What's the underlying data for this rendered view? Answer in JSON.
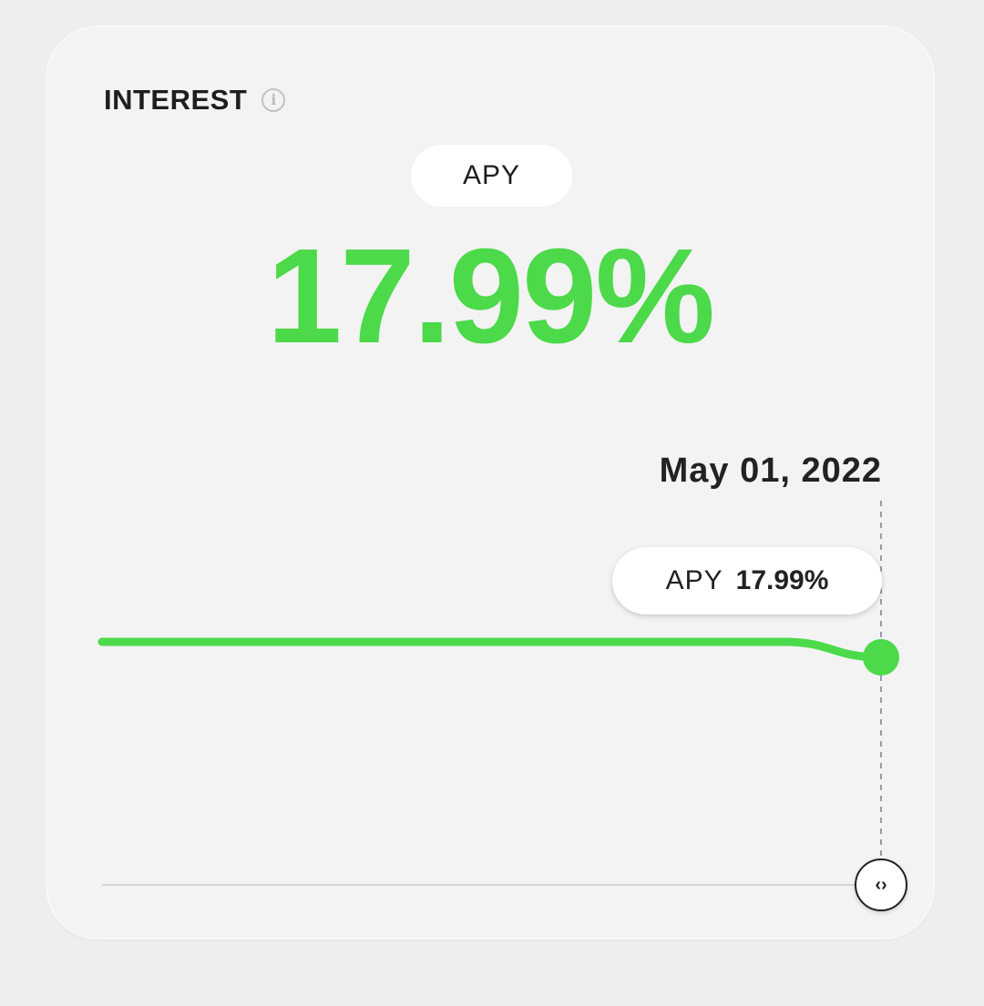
{
  "card": {
    "title": "INTEREST",
    "info_icon": "info-icon",
    "metric_pill": "APY",
    "main_value": "17.99%"
  },
  "colors": {
    "accent_green": "#4cd94a",
    "card_bg": "#f3f3f3",
    "text_dark": "#1e1e1e"
  },
  "tooltip": {
    "date": "May 01, 2022",
    "label": "APY",
    "value": "17.99%"
  },
  "scrubber": {
    "icon": "chevron-left-right-icon",
    "glyph": "‹›"
  },
  "chart_data": {
    "type": "line",
    "series": [
      {
        "values": [
          18.0,
          18.0,
          18.0,
          18.0,
          18.0,
          18.0,
          18.0,
          18.0,
          17.99
        ]
      }
    ],
    "grid": false,
    "selected_point": {
      "x": "May 01, 2022",
      "y": 17.99
    }
  }
}
